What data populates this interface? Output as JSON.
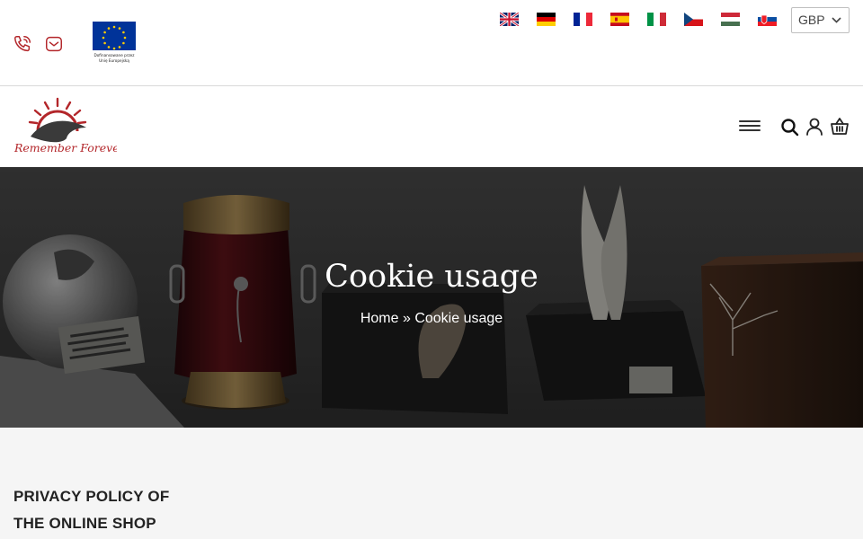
{
  "eu_logo": {
    "text_line1": "Dofinansowane przez",
    "text_line2": "Unię Europejską"
  },
  "languages": [
    {
      "code": "en",
      "icon": "flag-uk-icon"
    },
    {
      "code": "de",
      "icon": "flag-de-icon"
    },
    {
      "code": "fr",
      "icon": "flag-fr-icon"
    },
    {
      "code": "es",
      "icon": "flag-es-icon"
    },
    {
      "code": "it",
      "icon": "flag-it-icon"
    },
    {
      "code": "cz",
      "icon": "flag-cz-icon"
    },
    {
      "code": "hu",
      "icon": "flag-hu-icon"
    },
    {
      "code": "sk",
      "icon": "flag-sk-icon"
    }
  ],
  "currency": {
    "selected": "GBP"
  },
  "brand": {
    "name": "Remember Forever",
    "accent_color": "#b3262a"
  },
  "hero": {
    "title": "Cookie usage",
    "breadcrumb": {
      "home": "Home",
      "separator": "»",
      "current": "Cookie usage"
    }
  },
  "content": {
    "section_title": "PRIVACY POLICY OF THE ONLINE SHOP"
  }
}
